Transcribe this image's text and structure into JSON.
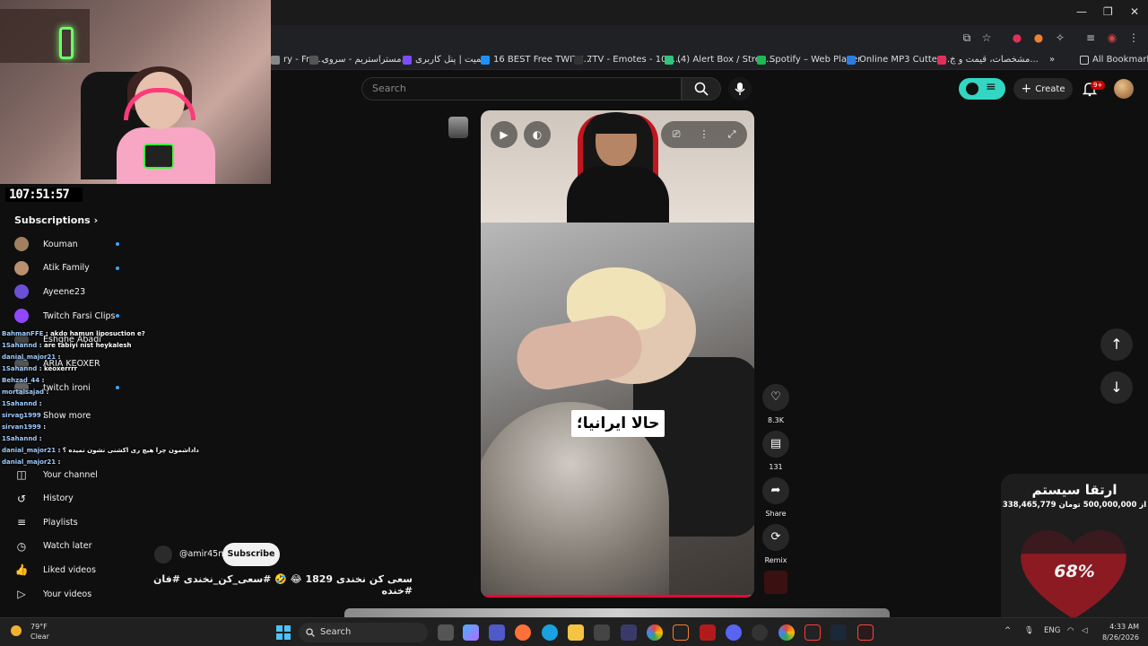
{
  "browser": {
    "bookmarks": [
      {
        "label": "ry - Fra...",
        "color": "#888"
      },
      {
        "label": "مستراستریم - سروی...",
        "color": "#555"
      },
      {
        "label": "ریمیت | پنل کاربری",
        "color": "#7b4dff"
      },
      {
        "label": "16 BEST Free TWITC...",
        "color": "#1e90ff"
      },
      {
        "label": "7TV - Emotes - 108...",
        "color": "#333"
      },
      {
        "label": "(4) Alert Box / Strea...",
        "color": "#31c27c"
      },
      {
        "label": "Spotify – Web Player",
        "color": "#1db954"
      },
      {
        "label": "Online MP3 Cutter -...",
        "color": "#2a7de1"
      },
      {
        "label": "مشخصات، قیمت و خ...",
        "color": "#e0305a"
      }
    ],
    "all_bookmarks": "All Bookmarks"
  },
  "stream": {
    "timer": "107:51:57"
  },
  "sidebar": {
    "subscriptions_label": "Subscriptions",
    "channels": [
      {
        "name": "Kouman",
        "color": "#a08060",
        "live": true
      },
      {
        "name": "Atik Family",
        "color": "#b89070",
        "live": true
      },
      {
        "name": "Ayeene23",
        "color": "#6b4fd6",
        "live": false
      },
      {
        "name": "Twitch Farsi Clips",
        "color": "#9146ff",
        "live": true
      },
      {
        "name": "Eshghe Abadi",
        "color": "#444",
        "live": false
      },
      {
        "name": "ARIA KEOXER",
        "color": "#555",
        "live": false
      },
      {
        "name": "twitch ironi",
        "color": "#666",
        "live": true
      }
    ],
    "show_more": "Show more",
    "you_items": [
      {
        "label": "Your channel",
        "icon": "person-box-icon",
        "glyph": "◫"
      },
      {
        "label": "History",
        "icon": "history-icon",
        "glyph": "↺"
      },
      {
        "label": "Playlists",
        "icon": "playlists-icon",
        "glyph": "≡"
      },
      {
        "label": "Watch later",
        "icon": "clock-icon",
        "glyph": "◷"
      },
      {
        "label": "Liked videos",
        "icon": "thumbs-up-icon",
        "glyph": "👍"
      },
      {
        "label": "Your videos",
        "icon": "video-icon",
        "glyph": "▷"
      }
    ]
  },
  "chat": [
    {
      "user": "BahmanFFE",
      "text": ": akdo hamun liposuction e?"
    },
    {
      "user": "1Sahannd",
      "text": ": are tabiyi nist heykalesh"
    },
    {
      "user": "danial_major21",
      "text": ":"
    },
    {
      "user": "1Sahannd",
      "text": ": keoxerrrr"
    },
    {
      "user": "Behzad_44",
      "text": ":"
    },
    {
      "user": "mortalsajad",
      "text": ":"
    },
    {
      "user": "1Sahannd",
      "text": ":"
    },
    {
      "user": "sirvan1999",
      "text": ":"
    },
    {
      "user": "sirvan1999",
      "text": ":"
    },
    {
      "user": "1Sahannd",
      "text": ":"
    },
    {
      "user": "danial_major21",
      "text": ": داداشمون چرا هیچ ری اکشنی نشون نمیده ؟"
    },
    {
      "user": "danial_major21",
      "text": ":"
    }
  ],
  "header": {
    "search_placeholder": "Search",
    "create_label": "Create",
    "notif_badge": "9+"
  },
  "short": {
    "caption": "حالا ایرانیا؛",
    "progress": 0.98,
    "likes": "8.3K",
    "comments": "131",
    "share_label": "Share",
    "remix_label": "Remix"
  },
  "channel": {
    "handle": "@amir45n",
    "subscribe_label": "Subscribe",
    "title": "سعی کن نخندی 1829 😂 🤣 #سعی_کن_نخندی #فان #خنده"
  },
  "donation": {
    "title": "ارتقا سیستم",
    "amount": "338,465,779 از 500,000,000 تومان",
    "percent_label": "68%",
    "percent": 68
  },
  "taskbar": {
    "temp": "79°F",
    "condition": "Clear",
    "search_label": "Search",
    "lang": "ENG",
    "time": "4:33 AM",
    "date": "8/26/2026"
  }
}
